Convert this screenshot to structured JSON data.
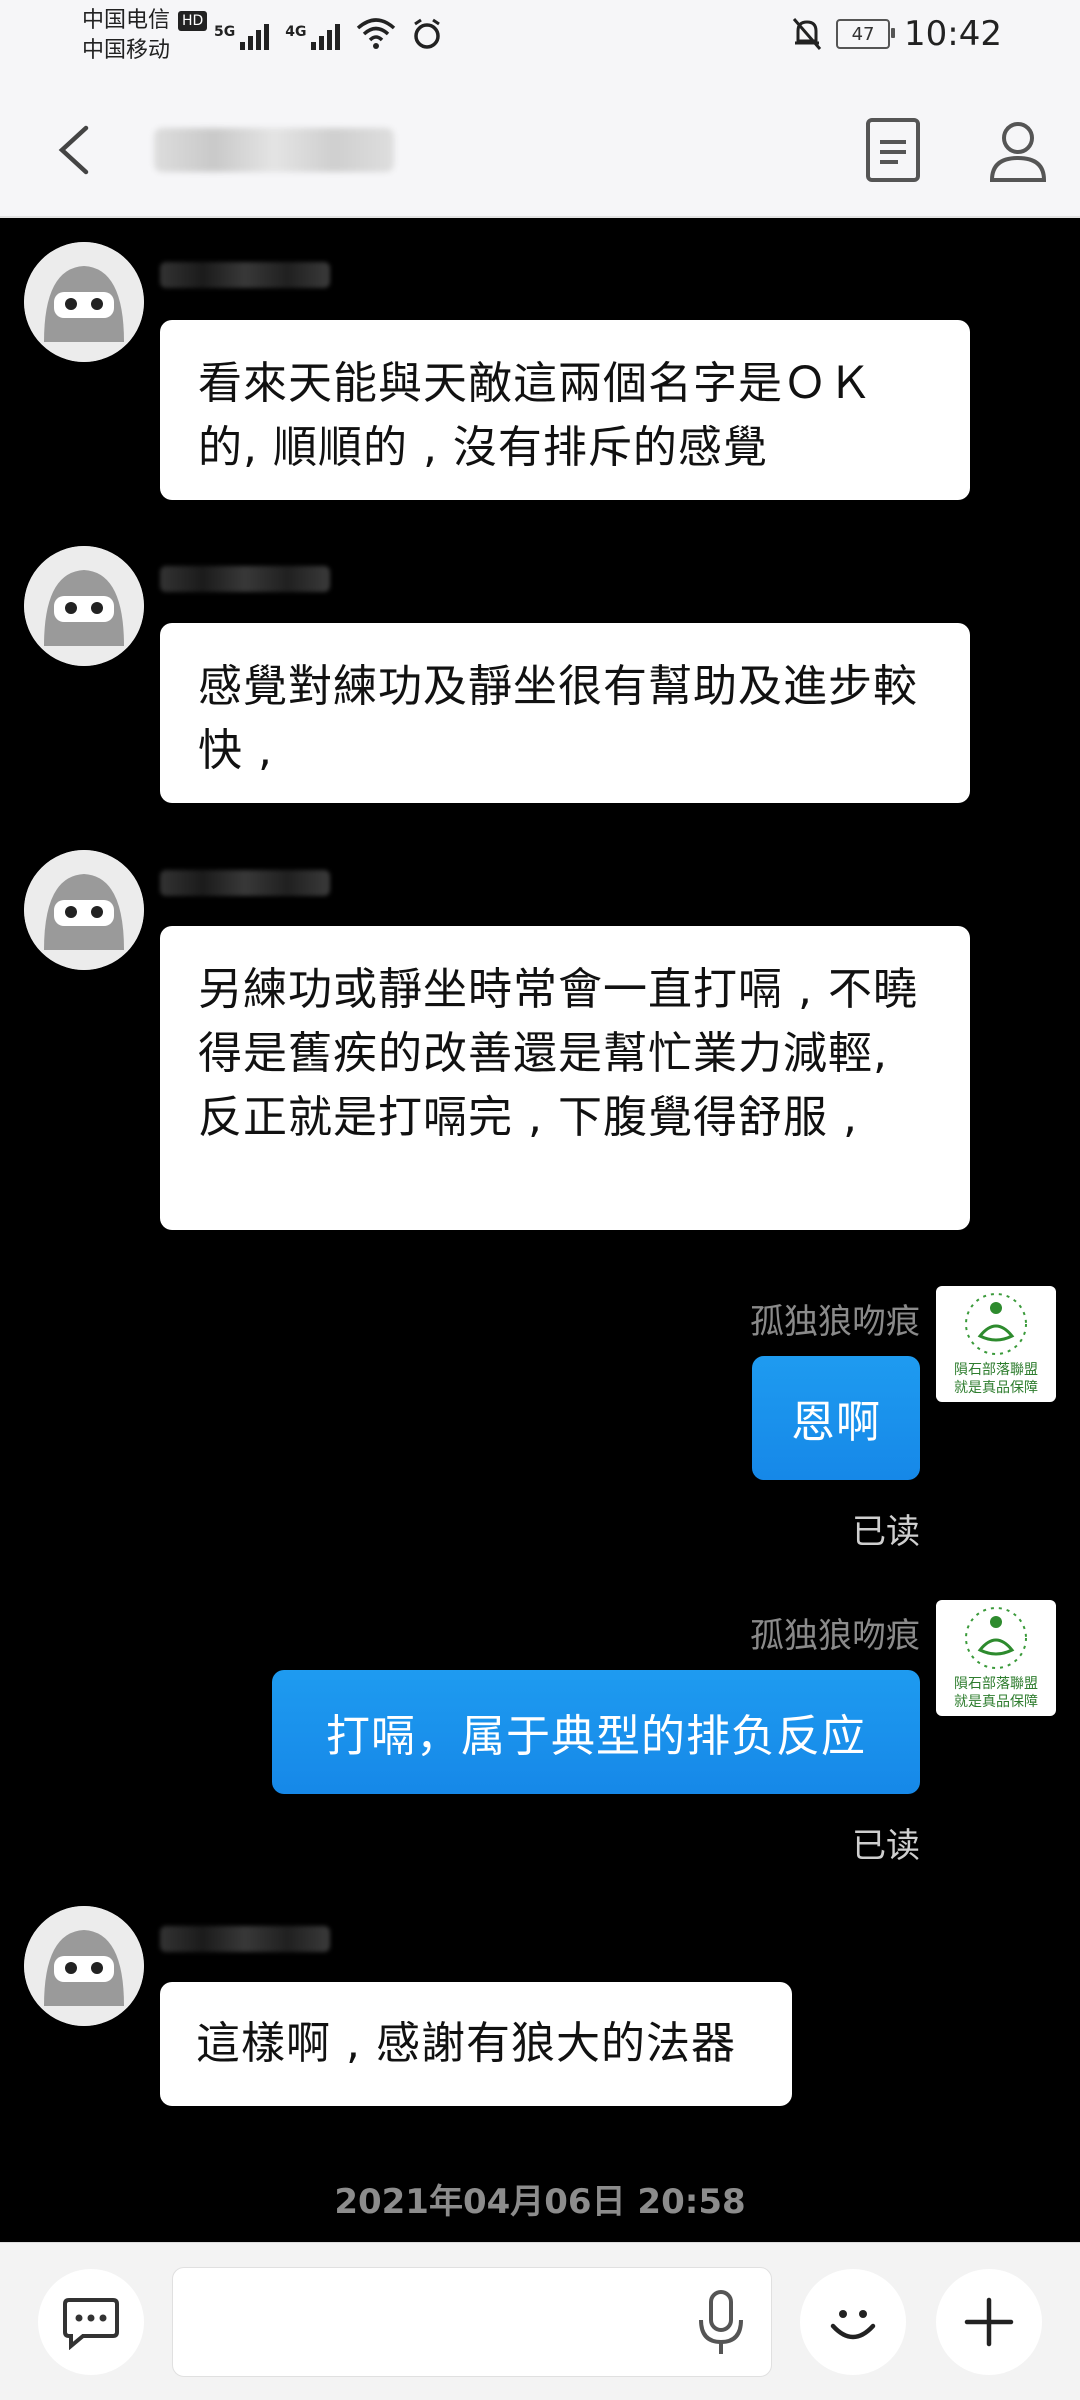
{
  "status_bar": {
    "carrier_1": "中国电信",
    "hd_badge": "HD",
    "carrier_2": "中国移动",
    "net_1": "5G",
    "net_2": "4G",
    "battery": "47",
    "time": "10:42"
  },
  "header": {
    "back_icon": "chevron-left-icon",
    "doc_icon": "document-icon",
    "profile_icon": "person-icon"
  },
  "messages": [
    {
      "side": "left",
      "text": "看來天能與天敵這兩個名字是ＯＫ的, 順順的 , 沒有排斥的感覺"
    },
    {
      "side": "left",
      "text": "感覺對練功及靜坐很有幫助及進步較快 ,"
    },
    {
      "side": "left",
      "text": "另練功或靜坐時常會一直打嗝 , 不曉得是舊疾的改善還是幫忙業力減輕, 反正就是打嗝完 , 下腹覺得舒服 ,"
    },
    {
      "side": "right",
      "sender": "孤独狼吻痕",
      "text": "恩啊",
      "status": "已读"
    },
    {
      "side": "right",
      "sender": "孤独狼吻痕",
      "text": "打嗝，属于典型的排负反应",
      "status": "已读"
    },
    {
      "side": "left",
      "text": "這樣啊 , 感謝有狼大的法器"
    }
  ],
  "right_avatar": {
    "line_1": "隕石部落聯盟",
    "line_2": "就是真品保障"
  },
  "timestamp": "2021年04月06日 20:58",
  "input_bar": {
    "chat_icon": "chat-bubble-icon",
    "mic_icon": "microphone-icon",
    "emoji_icon": "smiley-icon",
    "plus_icon": "plus-icon",
    "placeholder": ""
  }
}
